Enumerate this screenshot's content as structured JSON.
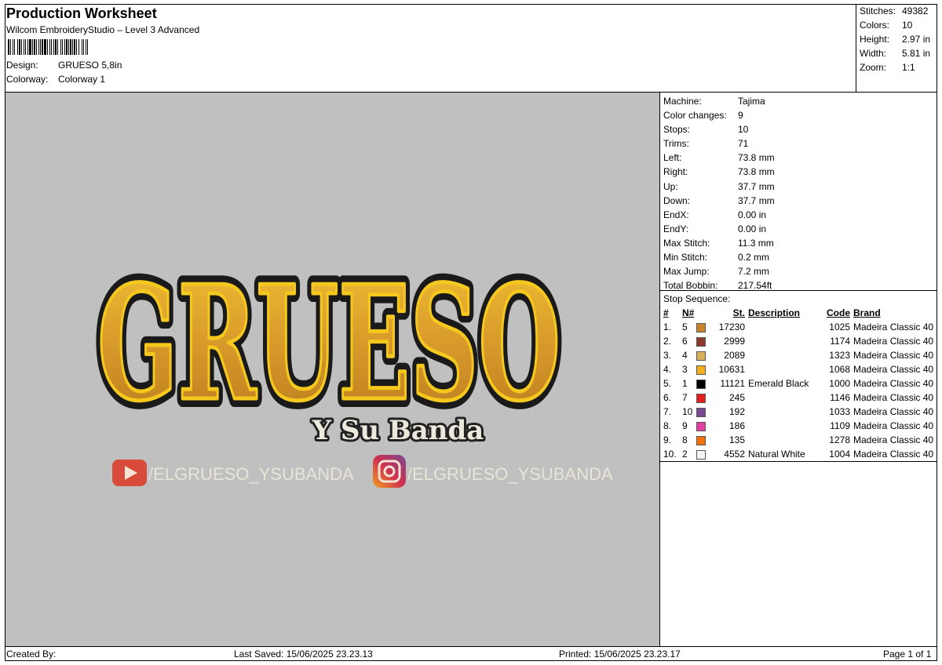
{
  "header": {
    "title": "Production Worksheet",
    "software": "Wilcom EmbroideryStudio – Level 3 Advanced",
    "design_label": "Design:",
    "design_value": "GRUESO 5,8in",
    "colorway_label": "Colorway:",
    "colorway_value": "Colorway 1"
  },
  "stats": [
    {
      "label": "Stitches:",
      "value": "49382"
    },
    {
      "label": "Colors:",
      "value": "10"
    },
    {
      "label": "Height:",
      "value": "2.97 in"
    },
    {
      "label": "Width:",
      "value": "5.81 in"
    },
    {
      "label": "Zoom:",
      "value": "1:1"
    }
  ],
  "machine_info": [
    {
      "label": "Machine:",
      "value": "Tajima"
    },
    {
      "label": "Color changes:",
      "value": "9"
    },
    {
      "label": "Stops:",
      "value": "10"
    },
    {
      "label": "Trims:",
      "value": "71"
    },
    {
      "label": "Left:",
      "value": "73.8 mm"
    },
    {
      "label": "Right:",
      "value": "73.8 mm"
    },
    {
      "label": "Up:",
      "value": "37.7 mm"
    },
    {
      "label": "Down:",
      "value": "37.7 mm"
    },
    {
      "label": "EndX:",
      "value": "0.00 in"
    },
    {
      "label": "EndY:",
      "value": "0.00 in"
    },
    {
      "label": "Max Stitch:",
      "value": "11.3 mm"
    },
    {
      "label": "Min Stitch:",
      "value": "0.2 mm"
    },
    {
      "label": "Max Jump:",
      "value": "7.2 mm"
    },
    {
      "label": "Total Bobbin:",
      "value": "217.54ft"
    }
  ],
  "stop_sequence": {
    "title": "Stop Sequence:",
    "headers": {
      "num": "#",
      "n": "N#",
      "st": "St.",
      "desc": "Description",
      "code": "Code",
      "brand": "Brand"
    },
    "rows": [
      {
        "idx": "1.",
        "n": "5",
        "color": "#c8842a",
        "st": "17230",
        "desc": "",
        "code": "1025",
        "brand": "Madeira Classic 40"
      },
      {
        "idx": "2.",
        "n": "6",
        "color": "#8b3a2e",
        "st": "2999",
        "desc": "",
        "code": "1174",
        "brand": "Madeira Classic 40"
      },
      {
        "idx": "3.",
        "n": "4",
        "color": "#d8b060",
        "st": "2089",
        "desc": "",
        "code": "1323",
        "brand": "Madeira Classic 40"
      },
      {
        "idx": "4.",
        "n": "3",
        "color": "#f0b020",
        "st": "10631",
        "desc": "",
        "code": "1068",
        "brand": "Madeira Classic 40"
      },
      {
        "idx": "5.",
        "n": "1",
        "color": "#000000",
        "st": "11121",
        "desc": "Emerald Black",
        "code": "1000",
        "brand": "Madeira Classic 40"
      },
      {
        "idx": "6.",
        "n": "7",
        "color": "#e02020",
        "st": "245",
        "desc": "",
        "code": "1146",
        "brand": "Madeira Classic 40"
      },
      {
        "idx": "7.",
        "n": "10",
        "color": "#7a4a90",
        "st": "192",
        "desc": "",
        "code": "1033",
        "brand": "Madeira Classic 40"
      },
      {
        "idx": "8.",
        "n": "9",
        "color": "#e040a0",
        "st": "186",
        "desc": "",
        "code": "1109",
        "brand": "Madeira Classic 40"
      },
      {
        "idx": "9.",
        "n": "8",
        "color": "#f07010",
        "st": "135",
        "desc": "",
        "code": "1278",
        "brand": "Madeira Classic 40"
      },
      {
        "idx": "10.",
        "n": "2",
        "color": "#f4f4f4",
        "st": "4552",
        "desc": "Natural White",
        "code": "1004",
        "brand": "Madeira Classic 40"
      }
    ]
  },
  "design_art": {
    "main_text": "GRUESO",
    "subtitle": "Y Su Banda",
    "youtube_handle": "/ELGRUESO_YSUBANDA",
    "instagram_handle": "/ELGRUESO_YSUBANDA"
  },
  "footer": {
    "created_by": "Created By:",
    "last_saved": "Last Saved: 15/06/2025 23.23.13",
    "printed": "Printed: 15/06/2025 23.23.17",
    "page": "Page 1 of 1"
  }
}
